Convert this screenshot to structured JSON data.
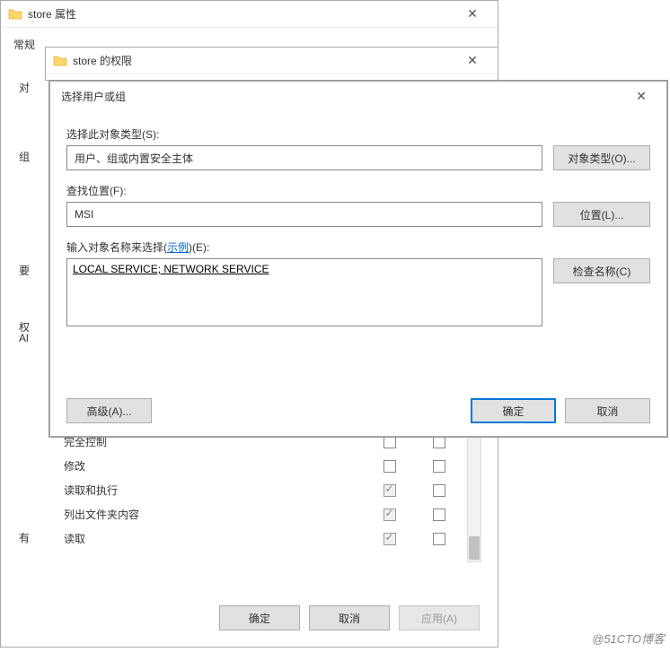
{
  "props_window": {
    "title": "store 属性",
    "tab_general": "常规",
    "label_obj": "对",
    "label_group": "组",
    "label_need": "要",
    "label_al": "Al",
    "label_perm_short": "权",
    "label_have": "有"
  },
  "perm_window": {
    "title": "store 的权限"
  },
  "select_dialog": {
    "title": "选择用户或组",
    "object_type_label": "选择此对象类型(S):",
    "object_type_value": "用户、组或内置安全主体",
    "object_type_btn": "对象类型(O)...",
    "location_label": "查找位置(F):",
    "location_value": "MSI",
    "location_btn": "位置(L)...",
    "names_label_pre": "输入对象名称来选择(",
    "names_label_link": "示例",
    "names_label_post": ")(E):",
    "names_value": "LOCAL SERVICE; NETWORK SERVICE",
    "check_btn": "检查名称(C)",
    "advanced_btn": "高级(A)...",
    "ok_btn": "确定",
    "cancel_btn": "取消"
  },
  "perm_table": {
    "rows": [
      {
        "name": "完全控制",
        "allow": false,
        "allow_checked": false,
        "deny_checked": false
      },
      {
        "name": "修改",
        "allow_checked": false,
        "deny_checked": false
      },
      {
        "name": "读取和执行",
        "allow_checked": true,
        "deny_checked": false
      },
      {
        "name": "列出文件夹内容",
        "allow_checked": true,
        "deny_checked": false
      },
      {
        "name": "读取",
        "allow_checked": true,
        "deny_checked": false
      }
    ]
  },
  "bottom": {
    "ok": "确定",
    "cancel": "取消",
    "apply": "应用(A)"
  },
  "watermark": "@51CTO博客"
}
